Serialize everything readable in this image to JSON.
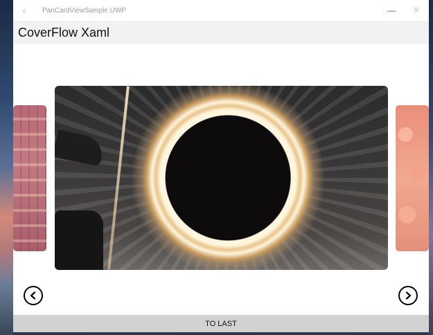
{
  "window": {
    "title": "PanCardViewSample.UWP",
    "back_icon": "chevron-left-icon",
    "minimize_icon": "minimize-icon",
    "close_icon": "close-icon"
  },
  "header": {
    "title": "CoverFlow Xaml"
  },
  "carousel": {
    "prev_icon": "chevron-left-circle-icon",
    "next_icon": "chevron-right-circle-icon"
  },
  "footer": {
    "button_label": "TO LAST"
  }
}
